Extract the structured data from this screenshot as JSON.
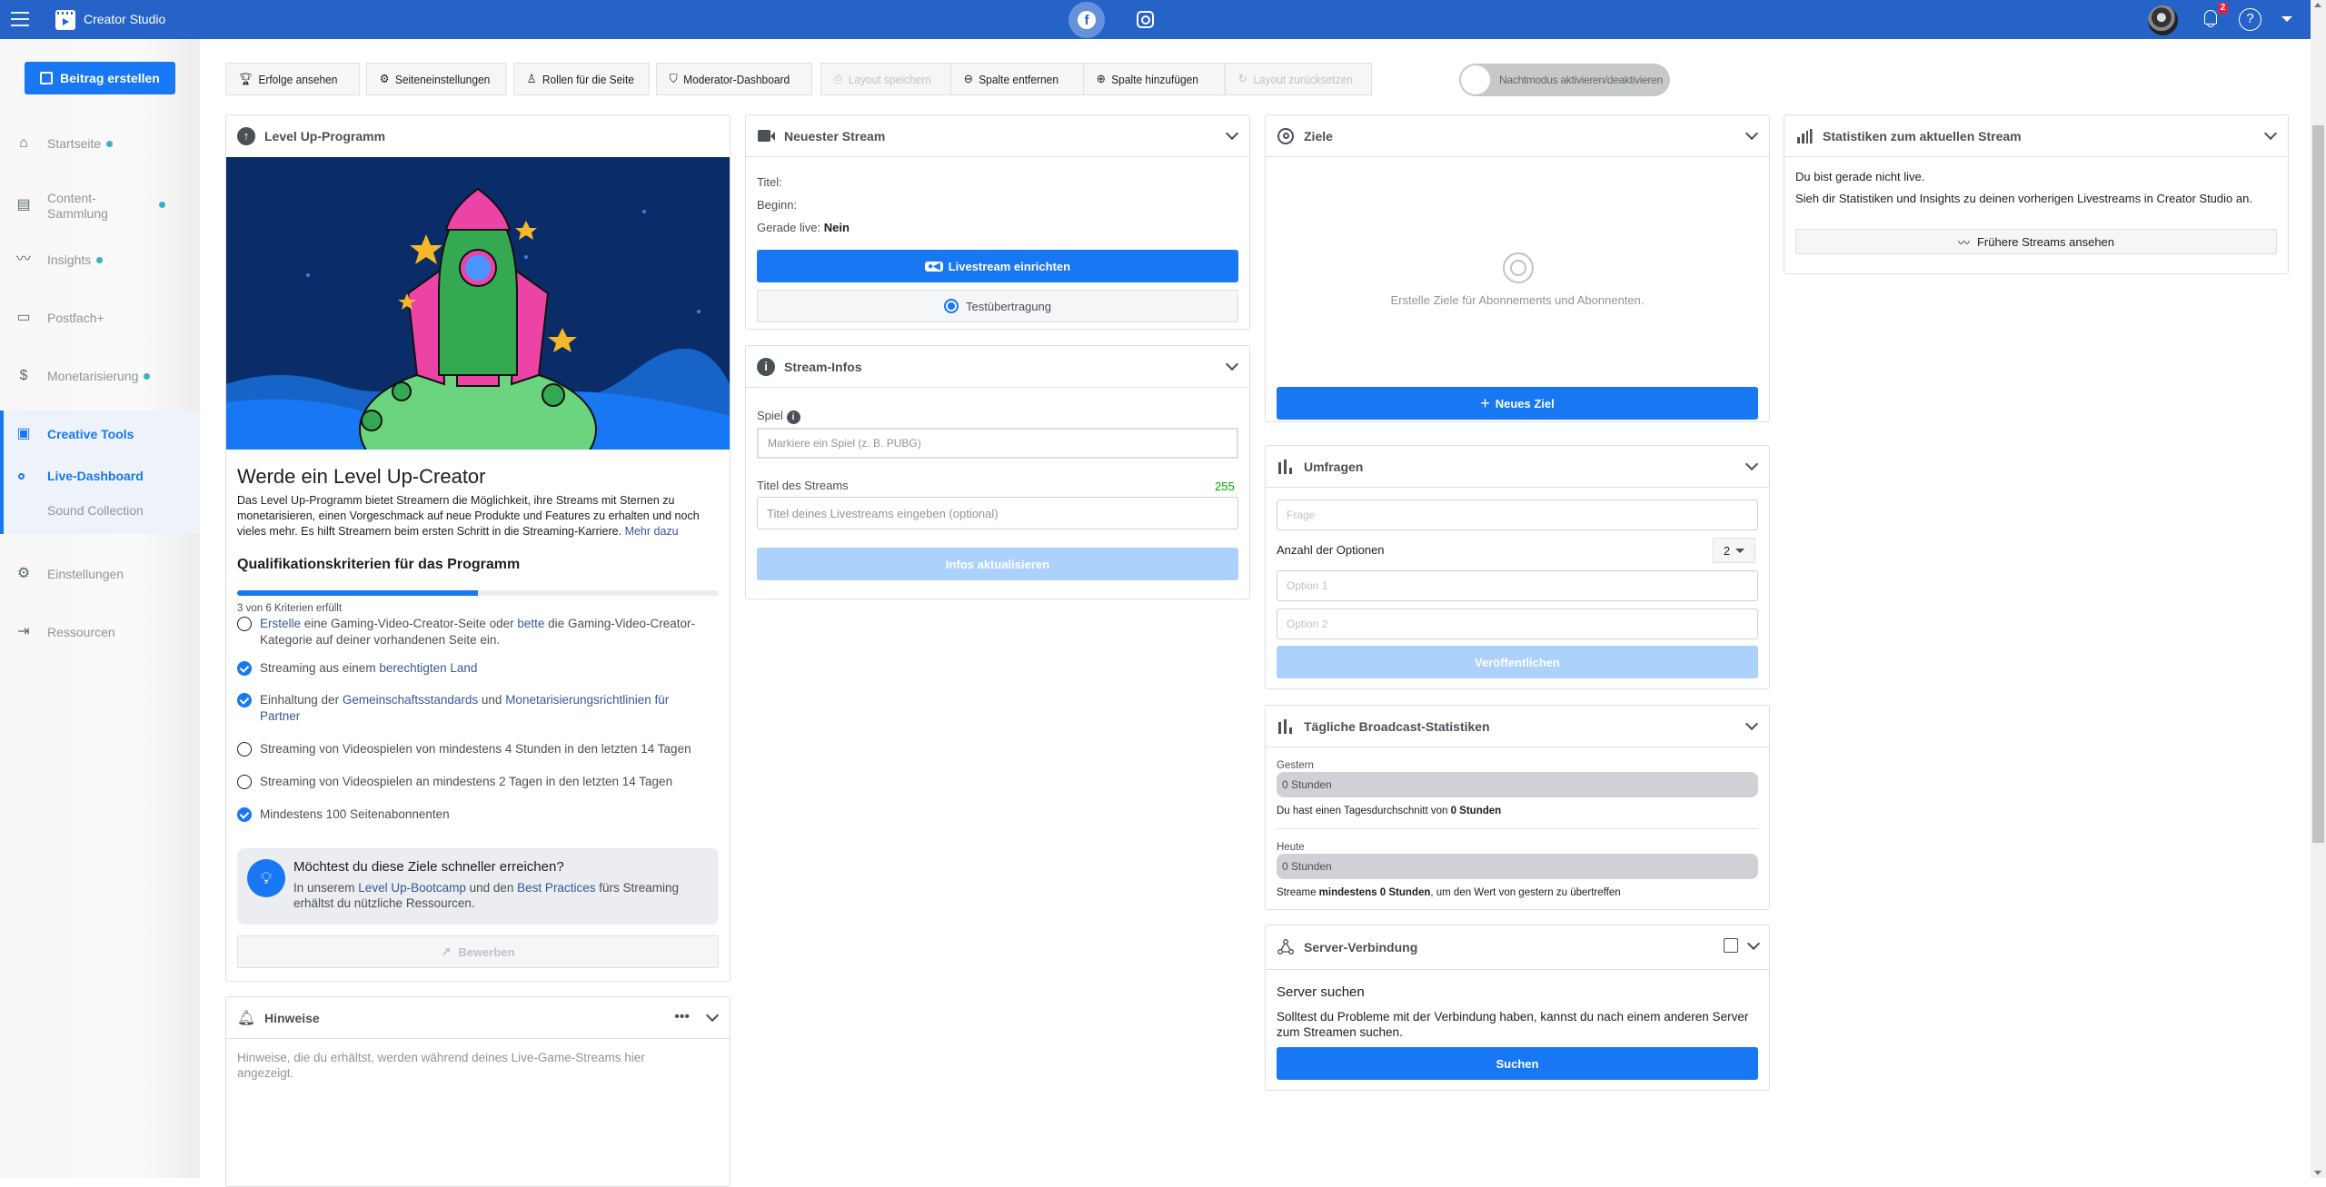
{
  "app": {
    "title": "Creator Studio"
  },
  "header": {
    "notification_count": "2",
    "help_glyph": "?"
  },
  "sidebar": {
    "create_post": "Beitrag erstellen",
    "items": [
      {
        "label": "Startseite",
        "icon": "home-icon",
        "dot": true
      },
      {
        "label": "Content-\nSammlung",
        "icon": "content-library-icon",
        "dot": true
      },
      {
        "label": "Insights",
        "icon": "insights-icon",
        "dot": true
      },
      {
        "label": "Postfach+",
        "icon": "inbox-icon",
        "dot": false
      },
      {
        "label": "Monetarisierung",
        "icon": "dollar-icon",
        "dot": true
      },
      {
        "label": "Creative Tools",
        "icon": "creative-tools-icon",
        "active": true
      },
      {
        "label": "Live-Dashboard",
        "sub": true,
        "active": true
      },
      {
        "label": "Sound Collection",
        "sub": true
      },
      {
        "label": "Einstellungen",
        "icon": "settings-user-icon"
      },
      {
        "label": "Ressourcen",
        "icon": "resources-icon"
      }
    ]
  },
  "toolbar": {
    "achievements": "Erfolge ansehen",
    "page_settings": "Seiteneinstellungen",
    "page_roles": "Rollen für die Seite",
    "moderator": "Moderator-Dashboard",
    "save_layout": "Layout speichern",
    "remove_column": "Spalte entfernen",
    "add_column": "Spalte hinzufügen",
    "reset_layout": "Layout zurücksetzen",
    "night_mode": "Nachtmodus aktivieren/deaktivieren"
  },
  "levelup": {
    "title": "Level Up-Programm",
    "heading": "Werde ein Level Up-Creator",
    "desc": "Das Level Up-Programm bietet Streamern die Möglichkeit, ihre Streams mit Sternen zu monetarisieren, einen Vorgeschmack auf neue Produkte und Features zu erhalten und noch vieles mehr. Es hilft Streamern beim ersten Schritt in die Streaming-Karriere.",
    "more": "Mehr dazu",
    "criteria_title": "Qualifikationskriterien für das Programm",
    "progress": 0.5,
    "progress_text": "3 von 6 Kriterien erfüllt",
    "criteria": [
      {
        "done": false,
        "parts": [
          [
            "Erstelle",
            true
          ],
          [
            " eine Gaming-Video-Creator-Seite oder ",
            false
          ],
          [
            "bette",
            true
          ],
          [
            " die Gaming-Video-Creator-Kategorie auf deiner vorhandenen Seite ein.",
            false
          ]
        ]
      },
      {
        "done": true,
        "parts": [
          [
            "Streaming aus einem ",
            false
          ],
          [
            "berechtigten Land",
            true
          ]
        ]
      },
      {
        "done": true,
        "parts": [
          [
            "Einhaltung der ",
            false
          ],
          [
            "Gemeinschaftsstandards",
            true
          ],
          [
            " und ",
            false
          ],
          [
            "Monetarisierungsrichtlinien für Partner",
            true
          ]
        ]
      },
      {
        "done": false,
        "parts": [
          [
            "Streaming von Videospielen von mindestens 4 Stunden in den letzten 14 Tagen",
            false
          ]
        ]
      },
      {
        "done": false,
        "parts": [
          [
            "Streaming von Videospielen an mindestens 2 Tagen in den letzten 14 Tagen",
            false
          ]
        ]
      },
      {
        "done": true,
        "parts": [
          [
            "Mindestens 100 Seitenabonnenten",
            false
          ]
        ]
      }
    ],
    "tip_title": "Möchtest du diese Ziele schneller erreichen?",
    "tip_pre": "In unserem ",
    "tip_link1": "Level Up-Bootcamp",
    "tip_mid": " und den ",
    "tip_link2": "Best Practices",
    "tip_post": " fürs Streaming erhältst du nützliche Ressourcen.",
    "apply": "Bewerben"
  },
  "hints": {
    "title": "Hinweise",
    "text": "Hinweise, die du erhältst, werden während deines Live-Game-Streams hier angezeigt."
  },
  "latest_stream": {
    "title": "Neuester Stream",
    "title_label": "Titel:",
    "start_label": "Beginn:",
    "live_label": "Gerade live:",
    "live_value": "Nein",
    "setup": "Livestream einrichten",
    "test": "Testübertragung"
  },
  "stream_info": {
    "title": "Stream-Infos",
    "game_label": "Spiel",
    "game_placeholder": "Markiere ein Spiel (z. B. PUBG)",
    "stream_title_label": "Titel des Streams",
    "char_count": "255",
    "stream_title_placeholder": "Titel deines Livestreams eingeben (optional)",
    "update": "Infos aktualisieren"
  },
  "goals": {
    "title": "Ziele",
    "empty": "Erstelle Ziele für Abonnements und Abonnenten.",
    "new": "Neues Ziel"
  },
  "polls": {
    "title": "Umfragen",
    "question_placeholder": "Frage",
    "options_label": "Anzahl der Optionen",
    "options_count": "2",
    "option1_placeholder": "Option 1",
    "option2_placeholder": "Option 2",
    "publish": "Veröffentlichen"
  },
  "daily_stats": {
    "title": "Tägliche Broadcast-Statistiken",
    "yesterday_label": "Gestern",
    "yesterday_value": "0 Stunden",
    "avg_pre": "Du hast einen Tagesdurchschnitt von ",
    "avg_value": "0 Stunden",
    "today_label": "Heute",
    "today_value": "0 Stunden",
    "beat_pre": "Streame ",
    "beat_bold": "mindestens 0 Stunden",
    "beat_post": ", um den Wert von gestern zu übertreffen"
  },
  "server": {
    "title": "Server-Verbindung",
    "heading": "Server suchen",
    "text": "Solltest du Probleme mit der Verbindung haben, kannst du nach einem anderen Server zum Streamen suchen.",
    "search": "Suchen"
  },
  "current_stats": {
    "title": "Statistiken zum aktuellen Stream",
    "not_live": "Du bist gerade nicht live.",
    "text": "Sieh dir Statistiken und Insights zu deinen vorherigen Livestreams in Creator Studio an.",
    "previous": "Frühere Streams ansehen"
  },
  "colors": {
    "header": "#2563c9",
    "primary": "#1877f2",
    "primary_disabled": "#add1fd",
    "count_green": "#00a400",
    "notif": "#e41e3f"
  }
}
